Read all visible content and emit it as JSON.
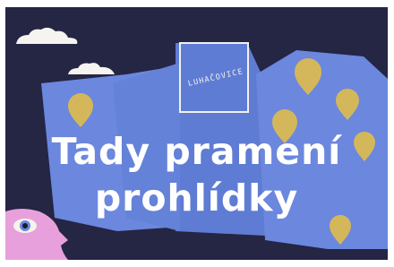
{
  "logo": {
    "text": "LUHAČOVICE"
  },
  "headline": {
    "line1": "Tady pramení",
    "line2": "prohlídky"
  },
  "colors": {
    "background": "#252544",
    "map": "#6a86dc",
    "map_dark": "#5b77d0",
    "pin": "#d4b75a",
    "cloud": "#f6f4f0",
    "face": "#e8a0dc"
  },
  "icons": [
    "cloud-icon",
    "map-pin-icon",
    "eye-icon"
  ]
}
